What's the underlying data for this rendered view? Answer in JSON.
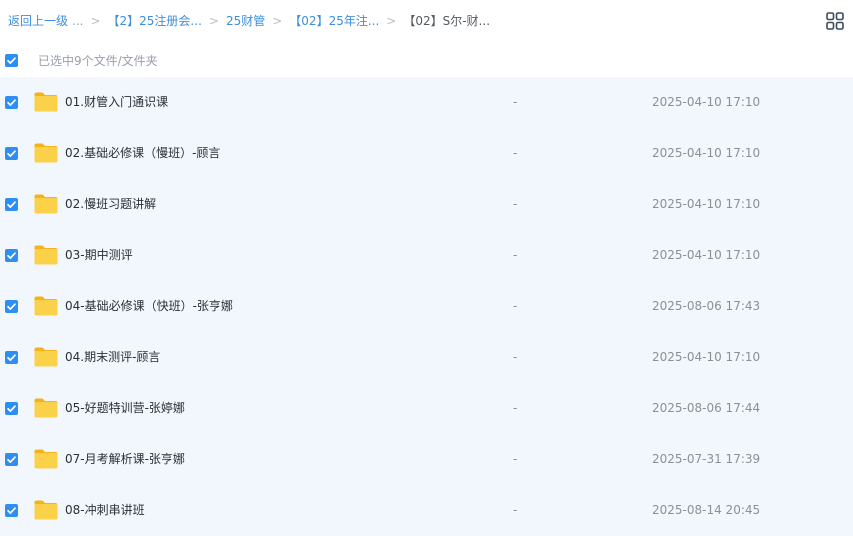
{
  "breadcrumb": {
    "back": "返回上一级",
    "ellipsis": "...",
    "items": [
      "【2】25注册会...",
      "25财管",
      "【02】25年注...",
      "【02】S尔-财..."
    ]
  },
  "toolbar": {
    "view_toggle_icon": "grid-view-icon"
  },
  "selection": {
    "text": "已选中9个文件/文件夹",
    "checked": true
  },
  "colors": {
    "accent": "#2f8ef2",
    "row_selected_bg": "#f1f7fd",
    "folder": "#fbc02d"
  },
  "files": [
    {
      "name": "01.财管入门通识课",
      "size": "-",
      "date": "2025-04-10 17:10",
      "icon": "folder-icon",
      "checked": true
    },
    {
      "name": "02.基础必修课（慢班）-顾言",
      "size": "-",
      "date": "2025-04-10 17:10",
      "icon": "folder-icon",
      "checked": true
    },
    {
      "name": "02.慢班习题讲解",
      "size": "-",
      "date": "2025-04-10 17:10",
      "icon": "folder-icon",
      "checked": true
    },
    {
      "name": "03-期中测评",
      "size": "-",
      "date": "2025-04-10 17:10",
      "icon": "folder-icon",
      "checked": true
    },
    {
      "name": "04-基础必修课（快班）-张亨娜",
      "size": "-",
      "date": "2025-08-06 17:43",
      "icon": "folder-icon",
      "checked": true
    },
    {
      "name": "04.期末测评-顾言",
      "size": "-",
      "date": "2025-04-10 17:10",
      "icon": "folder-icon",
      "checked": true
    },
    {
      "name": "05-好题特训营-张婷娜",
      "size": "-",
      "date": "2025-08-06 17:44",
      "icon": "folder-icon",
      "checked": true
    },
    {
      "name": "07-月考解析课-张亨娜",
      "size": "-",
      "date": "2025-07-31 17:39",
      "icon": "folder-icon",
      "checked": true
    },
    {
      "name": "08-冲刺串讲班",
      "size": "-",
      "date": "2025-08-14 20:45",
      "icon": "folder-icon",
      "checked": true
    }
  ]
}
